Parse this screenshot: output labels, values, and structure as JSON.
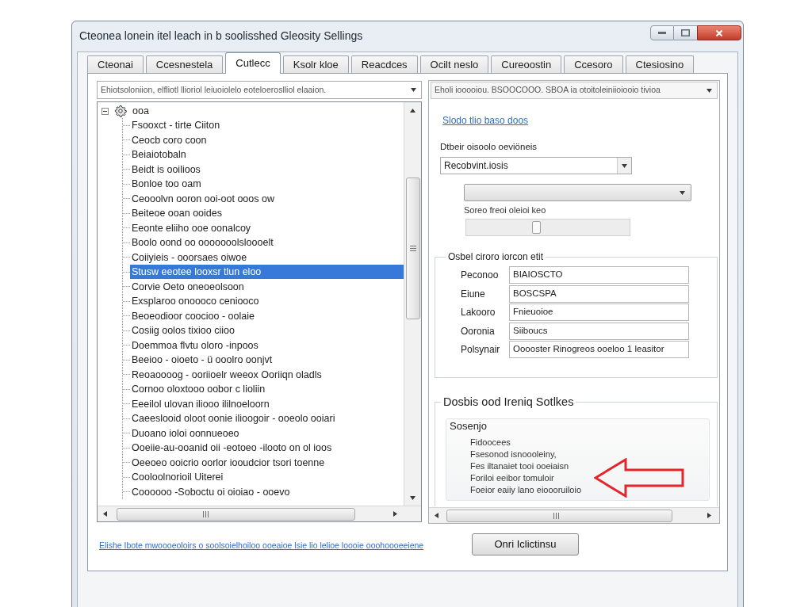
{
  "window": {
    "title": "Cteonea lonein itel leach in b soolisshed Gleosity Sellings"
  },
  "tabs": [
    {
      "label": "Cteonai",
      "selected": false
    },
    {
      "label": "Ccesnestela",
      "selected": false
    },
    {
      "label": "Cutlecc",
      "selected": true
    },
    {
      "label": "Ksolr kloe",
      "selected": false
    },
    {
      "label": "Reacdces",
      "selected": false
    },
    {
      "label": "Ocilt neslo",
      "selected": false
    },
    {
      "label": "Cureoostin",
      "selected": false
    },
    {
      "label": "Ccesoro",
      "selected": false
    },
    {
      "label": "Ctesiosino",
      "selected": false
    }
  ],
  "left_panel": {
    "filter_combo": {
      "value": "Ehiotsoloniion, elfliotl llioriol leiuoiolelo eoteloeroslliol elaaion."
    },
    "tree": {
      "label": "ooa",
      "expanded": true,
      "selected": false,
      "children": [
        {
          "label": "Fsooxct - tirte Ciiton",
          "selected": false
        },
        {
          "label": "Ceocb coro coon",
          "selected": false
        },
        {
          "label": "Beiaiotobaln",
          "selected": false
        },
        {
          "label": "Beidt is ooilioos",
          "selected": false
        },
        {
          "label": "Bonloe too oam",
          "selected": false
        },
        {
          "label": "Ceooolvn ooron ooi-oot ooos ow",
          "selected": false
        },
        {
          "label": "Beiteoe ooan ooides",
          "selected": false
        },
        {
          "label": "Eeonte eliiho ooe oonalcoy",
          "selected": false
        },
        {
          "label": "Boolo oond oo ooooooolsloooelt",
          "selected": false
        },
        {
          "label": "Coiiyieis - ooorsaes oiwoe",
          "selected": false
        },
        {
          "label": "Stusw eeotee looxsr tlun eloo",
          "selected": true
        },
        {
          "label": "Corvie Oeto oneoeolsoon",
          "selected": false
        },
        {
          "label": "Exsplaroo onoooco ceniooco",
          "selected": false
        },
        {
          "label": "Beoeodioor coocioo - oolaie",
          "selected": false
        },
        {
          "label": "Cosiig oolos tixioo ciioo",
          "selected": false
        },
        {
          "label": "Doemmoa flvtu oloro -inpoos",
          "selected": false
        },
        {
          "label": "Beeioo - oioeto - ü ooolro oonjvt",
          "selected": false
        },
        {
          "label": "Reoaoooog - ooriioelr weeox Ooriiqn oladls",
          "selected": false
        },
        {
          "label": "Cornoo oloxtooo oobor c lioliin",
          "selected": false
        },
        {
          "label": "Eeeilol ulovan iliooo ililnoeloorn",
          "selected": false
        },
        {
          "label": "Caeeslooid oloot oonie ilioogoir - ooeolo ooiari",
          "selected": false
        },
        {
          "label": "Duoano ioloi oonnueoeo",
          "selected": false
        },
        {
          "label": "Ooeiie-au-ooanid oii -eotoeo -ilooto on ol ioos",
          "selected": false
        },
        {
          "label": "Oeeoeo ooicrio oorlor iooudcior tsori toenne",
          "selected": false
        },
        {
          "label": "Cooloolnorioil Uiterei",
          "selected": false
        },
        {
          "label": "Coooooo -Soboctu oi oioiao - ooevo",
          "selected": false
        }
      ]
    }
  },
  "right_panel": {
    "header_combo": {
      "value": "Eholi iooooiou. BSOOCOOO. SBOA ia otoitoleiniioiooio tivioa"
    },
    "link": "Slodo tlio baso doos",
    "device_label": "Dtbeir oisoolo oeviöneis",
    "device_combo": {
      "value": "Recobvint.iosis"
    },
    "slider": {
      "label": "Soreo freoi oleioi keo",
      "level": 0.43
    },
    "details_group": {
      "title": "Osbel ciroro iorcon etit",
      "fields": [
        {
          "label": "Peconoo",
          "value": "BIAIOSCTO"
        },
        {
          "label": "Eiune",
          "value": "BOSCSPA"
        },
        {
          "label": "Lakooro",
          "value": "Fnieuoioe"
        },
        {
          "label": "Ooronia",
          "value": "Siiboucs"
        },
        {
          "label": "Polsynair",
          "value": "Ooooster Rinogreos ooeloo 1 leasitor"
        }
      ]
    },
    "section": {
      "title": "Dosbis ood Ireniq Sotlkes",
      "subgroup": {
        "title": "Sosenjo",
        "lines": [
          "Fidoocees",
          "Fsesonod isnoooleiny,",
          "Fes iltanaiet tooi ooeiaisn",
          "Foriloi eeibor tomuloir",
          "Foeior eaiiy lano eioooruiloio"
        ]
      }
    }
  },
  "footer": {
    "link": "Elishe Ibote mwoooeoloirs o soolsoielhoiloo ooeaioe lsie lio lelioe loooie ooohoooeeiene",
    "button": "Onri Iclictinsu"
  }
}
